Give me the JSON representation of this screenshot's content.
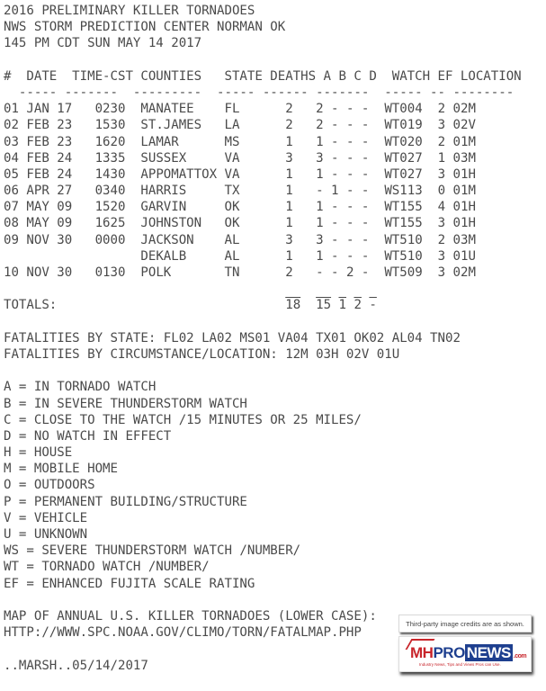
{
  "header": {
    "title": "2016 PRELIMINARY KILLER TORNADOES",
    "source": "NWS STORM PREDICTION CENTER NORMAN OK",
    "issued": "145 PM CDT SUN MAY 14 2017"
  },
  "table": {
    "columns": [
      "#",
      "DATE",
      "TIME-CST",
      "COUNTIES",
      "STATE",
      "DEATHS",
      "A",
      "B",
      "C",
      "D",
      "WATCH",
      "EF",
      "LOCATION"
    ],
    "header_line": "#  DATE  TIME-CST COUNTIES   STATE DEATHS A B C D  WATCH EF LOCATION",
    "dash_line": "  ----- -------  ---------  ----- ------ -------  ----- -- --------",
    "rows": [
      {
        "num": "01",
        "date": "JAN 17",
        "time": "0230",
        "county": "MANATEE",
        "state": "FL",
        "deaths": "2",
        "a": "2",
        "b": "-",
        "c": "-",
        "d": "-",
        "watch": "WT004",
        "ef": "2",
        "location": "02M"
      },
      {
        "num": "02",
        "date": "FEB 23",
        "time": "1530",
        "county": "ST.JAMES",
        "state": "LA",
        "deaths": "2",
        "a": "2",
        "b": "-",
        "c": "-",
        "d": "-",
        "watch": "WT019",
        "ef": "3",
        "location": "02V"
      },
      {
        "num": "03",
        "date": "FEB 23",
        "time": "1620",
        "county": "LAMAR",
        "state": "MS",
        "deaths": "1",
        "a": "1",
        "b": "-",
        "c": "-",
        "d": "-",
        "watch": "WT020",
        "ef": "2",
        "location": "01M"
      },
      {
        "num": "04",
        "date": "FEB 24",
        "time": "1335",
        "county": "SUSSEX",
        "state": "VA",
        "deaths": "3",
        "a": "3",
        "b": "-",
        "c": "-",
        "d": "-",
        "watch": "WT027",
        "ef": "1",
        "location": "03M"
      },
      {
        "num": "05",
        "date": "FEB 24",
        "time": "1430",
        "county": "APPOMATTOX",
        "state": "VA",
        "deaths": "1",
        "a": "1",
        "b": "-",
        "c": "-",
        "d": "-",
        "watch": "WT027",
        "ef": "3",
        "location": "01H"
      },
      {
        "num": "06",
        "date": "APR 27",
        "time": "0340",
        "county": "HARRIS",
        "state": "TX",
        "deaths": "1",
        "a": "-",
        "b": "1",
        "c": "-",
        "d": "-",
        "watch": "WS113",
        "ef": "0",
        "location": "01M"
      },
      {
        "num": "07",
        "date": "MAY 09",
        "time": "1520",
        "county": "GARVIN",
        "state": "OK",
        "deaths": "1",
        "a": "1",
        "b": "-",
        "c": "-",
        "d": "-",
        "watch": "WT155",
        "ef": "4",
        "location": "01H"
      },
      {
        "num": "08",
        "date": "MAY 09",
        "time": "1625",
        "county": "JOHNSTON",
        "state": "OK",
        "deaths": "1",
        "a": "1",
        "b": "-",
        "c": "-",
        "d": "-",
        "watch": "WT155",
        "ef": "3",
        "location": "01H"
      },
      {
        "num": "09",
        "date": "NOV 30",
        "time": "0000",
        "county": "JACKSON",
        "state": "AL",
        "deaths": "3",
        "a": "3",
        "b": "-",
        "c": "-",
        "d": "-",
        "watch": "WT510",
        "ef": "2",
        "location": "03M"
      },
      {
        "num": "",
        "date": "",
        "time": "",
        "county": "DEKALB",
        "state": "AL",
        "deaths": "1",
        "a": "1",
        "b": "-",
        "c": "-",
        "d": "-",
        "watch": "WT510",
        "ef": "3",
        "location": "01U"
      },
      {
        "num": "10",
        "date": "NOV 30",
        "time": "0130",
        "county": "POLK",
        "state": "TN",
        "deaths": "2",
        "a": "-",
        "b": "-",
        "c": "2",
        "d": "-",
        "watch": "WT509",
        "ef": "3",
        "location": "02M"
      }
    ],
    "totals_label": "TOTALS:",
    "totals": {
      "deaths": "18",
      "a": "15",
      "b": "1",
      "c": "2",
      "d": "-"
    }
  },
  "summary": {
    "by_state": "FATALITIES BY STATE: FL02 LA02 MS01 VA04 TX01 OK02 AL04 TN02",
    "by_location": "FATALITIES BY CIRCUMSTANCE/LOCATION: 12M 03H 02V 01U"
  },
  "legend": [
    "A = IN TORNADO WATCH",
    "B = IN SEVERE THUNDERSTORM WATCH",
    "C = CLOSE TO THE WATCH /15 MINUTES OR 25 MILES/",
    "D = NO WATCH IN EFFECT",
    "H = HOUSE",
    "M = MOBILE HOME",
    "O = OUTDOORS",
    "P = PERMANENT BUILDING/STRUCTURE",
    "V = VEHICLE",
    "U = UNKNOWN",
    "WS = SEVERE THUNDERSTORM WATCH /NUMBER/",
    "WT = TORNADO WATCH /NUMBER/",
    "EF = ENHANCED FUJITA SCALE RATING"
  ],
  "footer": {
    "map_note": "MAP OF ANNUAL U.S. KILLER TORNADOES (LOWER CASE):",
    "map_url": "HTTP://WWW.SPC.NOAA.GOV/CLIMO/TORN/FATALMAP.PHP",
    "signature": "..MARSH..05/14/2017"
  },
  "watermark": {
    "credit": "Third-party image credits are as shown.",
    "logo_mh": "MH",
    "logo_pro": "PRO",
    "logo_news": "NEWS",
    "logo_dotcom": ".com",
    "tagline": "Industry News, Tips and Views Pros can Use.",
    "colors": {
      "red": "#c8252b",
      "blue": "#1e3f8f"
    }
  }
}
